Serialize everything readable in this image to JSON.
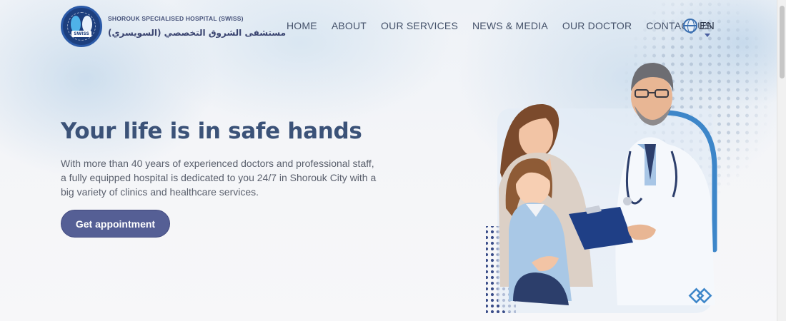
{
  "header": {
    "brand_en": "SHOROUK SPECIALISED HOSPITAL (SWISS)",
    "brand_ar": "مستشفى الشروق التخصصي (السويسري)",
    "logo_caption": "SWISS",
    "nav": [
      {
        "label": "HOME"
      },
      {
        "label": "ABOUT"
      },
      {
        "label": "OUR SERVICES"
      },
      {
        "label": "NEWS & MEDIA"
      },
      {
        "label": "OUR DOCTOR"
      },
      {
        "label": "CONTACT US"
      }
    ],
    "language": "EN",
    "language_icon": "globe-icon"
  },
  "hero": {
    "title": "Your life is in safe hands",
    "description": "With more than 40 years of experienced doctors and professional staff, a fully equipped hospital is dedicated to you 24/7 in Shorouk City with a big variety of clinics and healthcare services.",
    "cta_label": "Get appointment"
  },
  "colors": {
    "accent": "#555f95",
    "title": "#3b5278",
    "ring": "#3d86c9"
  }
}
